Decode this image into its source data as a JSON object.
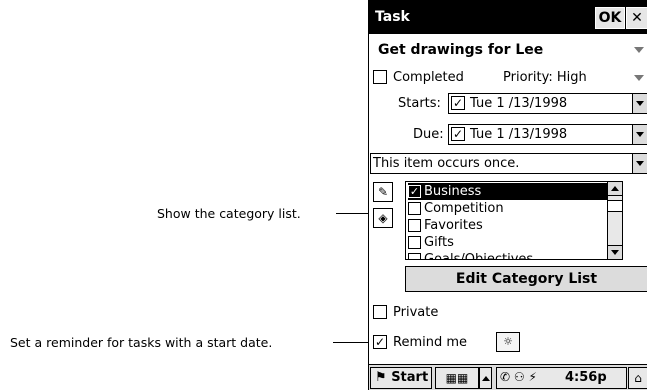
{
  "callouts": {
    "category": "Show the category list.",
    "reminder": "Set a reminder for tasks with a start date."
  },
  "window": {
    "title": "Task",
    "ok": "OK",
    "close": "✕"
  },
  "task": {
    "subject": "Get drawings for Lee",
    "completed_label": "Completed",
    "completed_checked": false,
    "priority_label": "Priority: High"
  },
  "dates": {
    "starts_label": "Starts:",
    "starts_value": "Tue   1 /13/1998",
    "starts_checked": true,
    "due_label": "Due:",
    "due_value": "Tue   1 /13/1998",
    "due_checked": true
  },
  "recurrence": "This item occurs once.",
  "categories": {
    "items": [
      {
        "label": "Business",
        "checked": true,
        "selected": true
      },
      {
        "label": "Competition",
        "checked": false,
        "selected": false
      },
      {
        "label": "Favorites",
        "checked": false,
        "selected": false
      },
      {
        "label": "Gifts",
        "checked": false,
        "selected": false
      },
      {
        "label": "Goals/Objectives",
        "checked": false,
        "selected": false
      }
    ],
    "edit_button": "Edit Category List"
  },
  "private": {
    "label": "Private",
    "checked": false
  },
  "reminder": {
    "label": "Remind me",
    "checked": true
  },
  "taskbar": {
    "start": "Start",
    "clock": "4:56p"
  },
  "icons": {
    "category_icon": "tag-icon",
    "notes_icon": "notes-icon",
    "alarm_icon": "alarm-options-icon",
    "start_icon": "windows-flag-icon",
    "keyboard_icon": "keyboard-icon",
    "desktop_icon": "desktop-icon"
  },
  "colors": {
    "titlebar_bg": "#000000",
    "selection_bg": "#000000",
    "button_face": "#dcdcdc"
  }
}
